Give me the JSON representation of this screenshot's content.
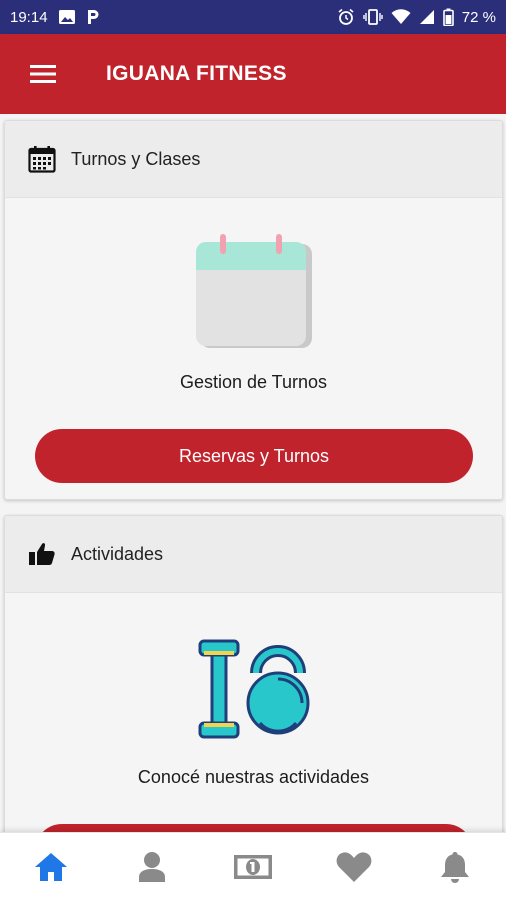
{
  "status_bar": {
    "time": "19:14",
    "battery": "72 %",
    "left_icons": [
      "image-icon",
      "p-app-icon"
    ],
    "right_icons": [
      "alarm-icon",
      "vibrate-icon",
      "wifi-icon",
      "signal-icon",
      "battery-icon"
    ]
  },
  "app_bar": {
    "title": "IGUANA FITNESS",
    "background": "#c1232c",
    "menu_icon": "hamburger-icon"
  },
  "cards": [
    {
      "header_icon": "calendar-icon",
      "header_title": "Turnos y Clases",
      "illustration": "calendar-illustration",
      "caption": "Gestion de Turnos",
      "button_label": "Reservas y Turnos"
    },
    {
      "header_icon": "thumbs-up-icon",
      "header_title": "Actividades",
      "illustration": "dumbbell-kettlebell-illustration",
      "caption": "Conocé nuestras actividades",
      "button_label": ""
    }
  ],
  "bottom_nav": {
    "active_color": "#1f78e6",
    "inactive_color": "#8a8a8a",
    "items": [
      {
        "icon": "home-icon",
        "active": true
      },
      {
        "icon": "user-icon",
        "active": false
      },
      {
        "icon": "money-icon",
        "active": false
      },
      {
        "icon": "heart-icon",
        "active": false
      },
      {
        "icon": "bell-icon",
        "active": false
      }
    ]
  }
}
